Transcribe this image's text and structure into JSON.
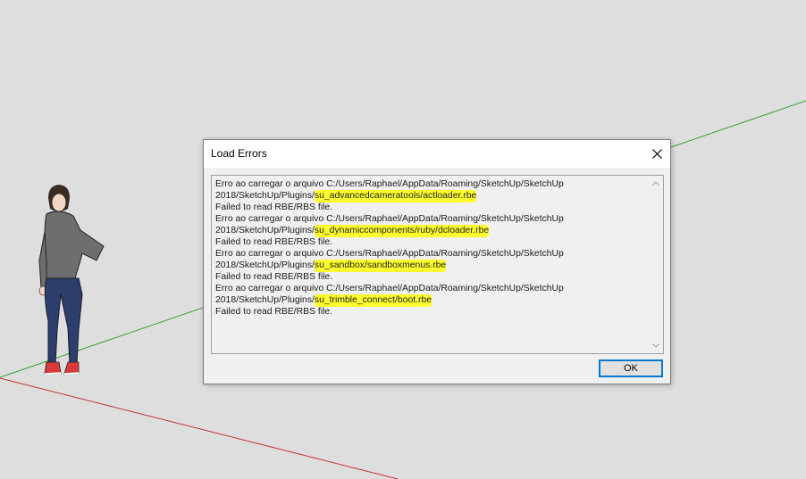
{
  "window": {
    "title": "Load Errors"
  },
  "icons": {
    "close": "close-icon",
    "scroll_up": "chevron-up-icon",
    "scroll_down": "chevron-down-icon"
  },
  "errors": [
    {
      "prefix": "Erro ao carregar o arquivo C:/Users/Raphael/AppData/Roaming/SketchUp/SketchUp",
      "path": "2018/SketchUp/Plugins/",
      "file": "su_advancedcameratools/actloader.rbe",
      "message": "Failed to read RBE/RBS file."
    },
    {
      "prefix": "Erro ao carregar o arquivo C:/Users/Raphael/AppData/Roaming/SketchUp/SketchUp",
      "path": "2018/SketchUp/Plugins/",
      "file": "su_dynamiccomponents/ruby/dcloader.rbe",
      "message": "Failed to read RBE/RBS file."
    },
    {
      "prefix": "Erro ao carregar o arquivo C:/Users/Raphael/AppData/Roaming/SketchUp/SketchUp",
      "path": "2018/SketchUp/Plugins/",
      "file": "su_sandbox/sandboxmenus.rbe",
      "message": "Failed to read RBE/RBS file."
    },
    {
      "prefix": "Erro ao carregar o arquivo C:/Users/Raphael/AppData/Roaming/SketchUp/SketchUp",
      "path": "2018/SketchUp/Plugins/",
      "file": "su_trimble_connect/boot.rbe",
      "message": "Failed to read RBE/RBS file."
    }
  ],
  "buttons": {
    "ok": "OK"
  },
  "colors": {
    "highlight": "#ffff2d",
    "green_axis": "#2ea32e",
    "red_axis": "#c83030",
    "accent": "#0078d7",
    "background": "#dedede"
  }
}
